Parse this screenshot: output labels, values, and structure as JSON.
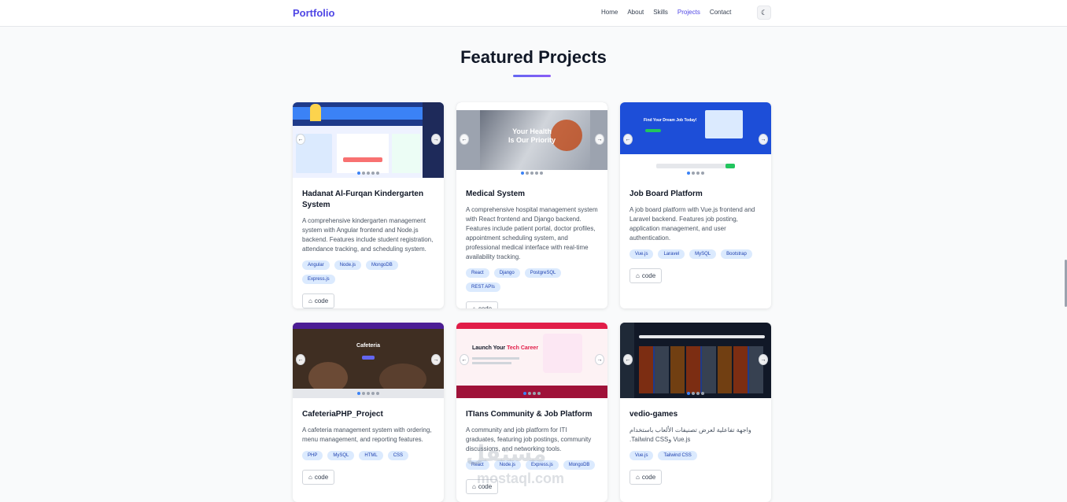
{
  "nav": {
    "brand": "Portfolio",
    "links": [
      "Home",
      "About",
      "Skills",
      "Projects",
      "Contact"
    ],
    "active_link": "Projects",
    "theme_icon": "moon-icon"
  },
  "section": {
    "title": "Featured Projects"
  },
  "projects": [
    {
      "title": "Hadanat Al-Furqan Kindergarten System",
      "description": "A comprehensive kindergarten management system with Angular frontend and Node.js backend. Features include student registration, attendance tracking, and scheduling system.",
      "tags": [
        "Angular",
        "Node.js",
        "MongoDB",
        "Express.js"
      ],
      "code_label": "code"
    },
    {
      "title": "Medical System",
      "description": "A comprehensive hospital management system with React frontend and Django backend. Features include patient portal, doctor profiles, appointment scheduling system, and professional medical interface with real-time availability tracking.",
      "tags": [
        "React",
        "Django",
        "PostgreSQL",
        "REST APIs"
      ],
      "code_label": "code",
      "thumb_text": [
        "Your Health",
        "Is Our Priority"
      ]
    },
    {
      "title": "Job Board Platform",
      "description": "A job board platform with Vue.js frontend and Laravel backend. Features job posting, application management, and user authentication.",
      "tags": [
        "Vue.js",
        "Laravel",
        "MySQL",
        "Bootstrap"
      ],
      "code_label": "code",
      "thumb_text": [
        "Find Your Dream Job Today!"
      ]
    },
    {
      "title": "CafeteriaPHP_Project",
      "description": "A cafeteria management system with ordering, menu management, and reporting features.",
      "tags": [
        "PHP",
        "MySQL",
        "HTML",
        "CSS"
      ],
      "code_label": "code",
      "thumb_text": [
        "Cafeteria"
      ]
    },
    {
      "title": "ITIans Community & Job Platform",
      "description": "A community and job platform for ITI graduates, featuring job postings, community discussions, and networking tools.",
      "tags": [
        "React",
        "Node.js",
        "Express.js",
        "MongoDB"
      ],
      "code_label": "code",
      "thumb_text": [
        "Launch Your",
        "Tech Career"
      ]
    },
    {
      "title": "vedio-games",
      "description": "واجهة تفاعلية لعرض تصنيفات الألعاب باستخدام Vue.js وTailwind CSS.",
      "tags": [
        "Vue.js",
        "Tailwind CSS"
      ],
      "code_label": "code"
    }
  ],
  "colors": {
    "accent": "#4f46e5",
    "tag_bg": "#dbeafe",
    "tag_text": "#1e40af"
  },
  "watermark": [
    "مستقل",
    "mostaql.com"
  ]
}
